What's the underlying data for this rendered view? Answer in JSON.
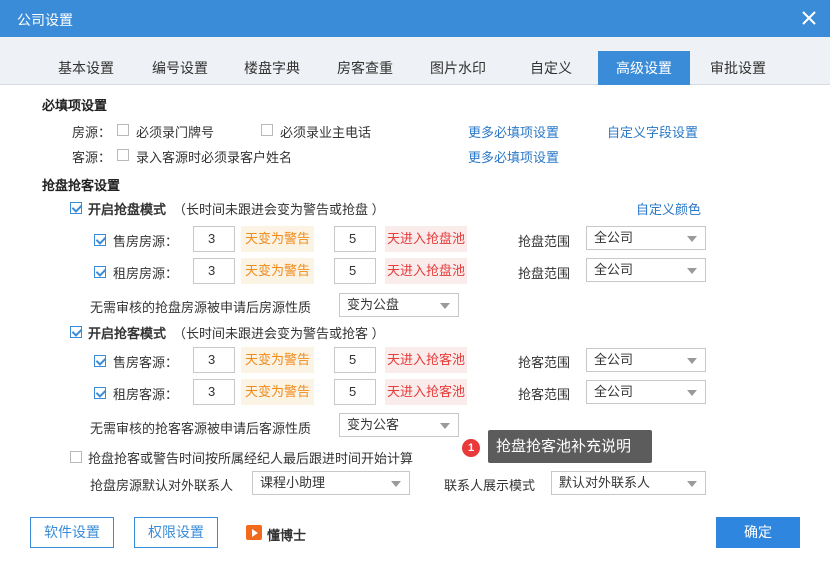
{
  "window": {
    "title": "公司设置"
  },
  "tabs": [
    "基本设置",
    "编号设置",
    "楼盘字典",
    "房客查重",
    "图片水印",
    "自定义",
    "高级设置",
    "审批设置"
  ],
  "required": {
    "title": "必填项设置",
    "house_label": "房源：",
    "house_opt1": "必须录门牌号",
    "house_opt2": "必须录业主电话",
    "more_link1": "更多必填项设置",
    "custom_field_link": "自定义字段设置",
    "client_label": "客源：",
    "client_opt1": "录入客源时必须录客户姓名",
    "more_link2": "更多必填项设置"
  },
  "grab": {
    "title": "抢盘抢客设置",
    "house_mode": {
      "label": "开启抢盘模式",
      "desc": "（长时间未跟进会变为警告或抢盘 ）",
      "checked": true
    },
    "custom_color_link": "自定义颜色",
    "sale_house": {
      "label": "售房房源：",
      "days_warn": "3",
      "warn_text": "天变为警告",
      "days_pool": "5",
      "pool_text": "天进入抢盘池",
      "scope_label": "抢盘范围",
      "scope_value": "全公司"
    },
    "rent_house": {
      "label": "租房房源：",
      "days_warn": "3",
      "warn_text": "天变为警告",
      "days_pool": "5",
      "pool_text": "天进入抢盘池",
      "scope_label": "抢盘范围",
      "scope_value": "全公司"
    },
    "house_nature_label": "无需审核的抢盘房源被申请后房源性质",
    "house_nature_value": "变为公盘",
    "client_mode": {
      "label": "开启抢客模式",
      "desc": "（长时间未跟进会变为警告或抢客 ）",
      "checked": true
    },
    "sale_client": {
      "label": "售房客源：",
      "days_warn": "3",
      "warn_text": "天变为警告",
      "days_pool": "5",
      "pool_text": "天进入抢客池",
      "scope_label": "抢客范围",
      "scope_value": "全公司"
    },
    "rent_client": {
      "label": "租房客源：",
      "days_warn": "3",
      "warn_text": "天变为警告",
      "days_pool": "5",
      "pool_text": "天进入抢客池",
      "scope_label": "抢客范围",
      "scope_value": "全公司"
    },
    "client_nature_label": "无需审核的抢客客源被申请后客源性质",
    "client_nature_value": "变为公客",
    "time_calc_label": "抢盘抢客或警告时间按所属经纪人最后跟进时间开始计算",
    "default_contact_label": "抢盘房源默认对外联系人",
    "default_contact_value": "课程小助理",
    "contact_mode_label": "联系人展示模式",
    "contact_mode_value": "默认对外联系人"
  },
  "tooltip": {
    "badge": "1",
    "text": "抢盘抢客池补充说明"
  },
  "footer": {
    "software_btn": "软件设置",
    "permission_btn": "权限设置",
    "brand": "懂博士",
    "confirm_btn": "确定"
  }
}
